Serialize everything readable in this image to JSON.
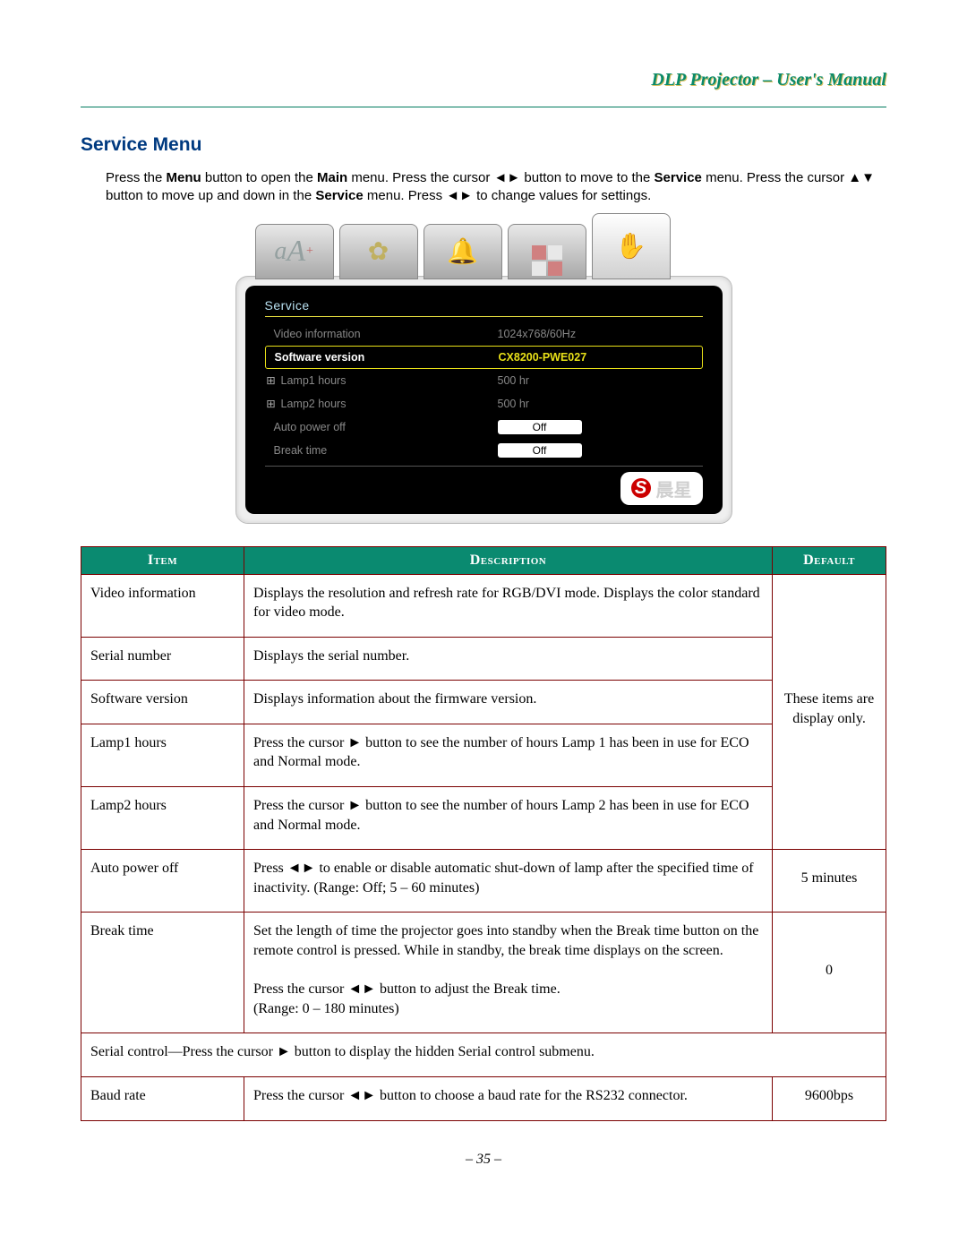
{
  "header": {
    "title": "DLP Projector – User's Manual"
  },
  "section_title": "Service Menu",
  "intro": {
    "p1a": "Press the ",
    "b1": "Menu",
    "p1b": " button to open the ",
    "b2": "Main",
    "p1c": " menu. Press the cursor ◄► button to move to the ",
    "b3": "Service",
    "p1d": " menu. Press the cursor ▲▼ button to move up and down in the ",
    "b4": "Service",
    "p1e": " menu. Press ◄► to change values for settings."
  },
  "osd": {
    "title": "Service",
    "rows": [
      {
        "label": "Video information",
        "value": "1024x768/60Hz",
        "type": "text"
      },
      {
        "label": "Software version",
        "value": "CX8200-PWE027",
        "type": "selected"
      },
      {
        "label": "Lamp1 hours",
        "value": "500 hr",
        "type": "plus"
      },
      {
        "label": "Lamp2 hours",
        "value": "500 hr",
        "type": "text"
      },
      {
        "label": "Auto power off",
        "value": "Off",
        "type": "pill"
      },
      {
        "label": "Break time",
        "value": "Off",
        "type": "pill"
      }
    ],
    "logo": "晨星"
  },
  "table": {
    "headers": {
      "item": "Item",
      "desc": "Description",
      "def": "Default"
    },
    "display_only_note": "These items are display only.",
    "rows_top": [
      {
        "item": "Video information",
        "desc": "Displays the resolution and refresh rate for RGB/DVI mode. Displays the color standard for video mode."
      },
      {
        "item": "Serial number",
        "desc": "Displays the serial number."
      },
      {
        "item": "Software version",
        "desc": "Displays information about the firmware version."
      },
      {
        "item": "Lamp1 hours",
        "desc": "Press the cursor ► button to see the number of hours Lamp 1 has been in use for ECO and Normal mode."
      },
      {
        "item": "Lamp2 hours",
        "desc": "Press the cursor ► button to see the number of hours Lamp 2 has been in use for ECO and Normal mode."
      }
    ],
    "rows_bottom": [
      {
        "item": "Auto power off",
        "desc": "Press ◄► to enable or disable automatic shut-down of lamp after the specified time of inactivity. (Range: Off; 5 – 60 minutes)",
        "def": "5 minutes"
      },
      {
        "item": "Break time",
        "desc": "Set the length of time the projector goes into standby when the Break time button on the remote control is pressed. While in standby, the break time displays on the screen.\n\nPress the cursor ◄► button to adjust the Break time.\n(Range: 0 – 180 minutes)",
        "def": "0"
      }
    ],
    "serial_row": "Serial control—Press the cursor ► button to display the hidden Serial control submenu.",
    "baud": {
      "item": "Baud rate",
      "desc": "Press the cursor ◄► button to choose a baud rate for the RS232 connector.",
      "def": "9600bps"
    }
  },
  "page_number": "– 35 –"
}
